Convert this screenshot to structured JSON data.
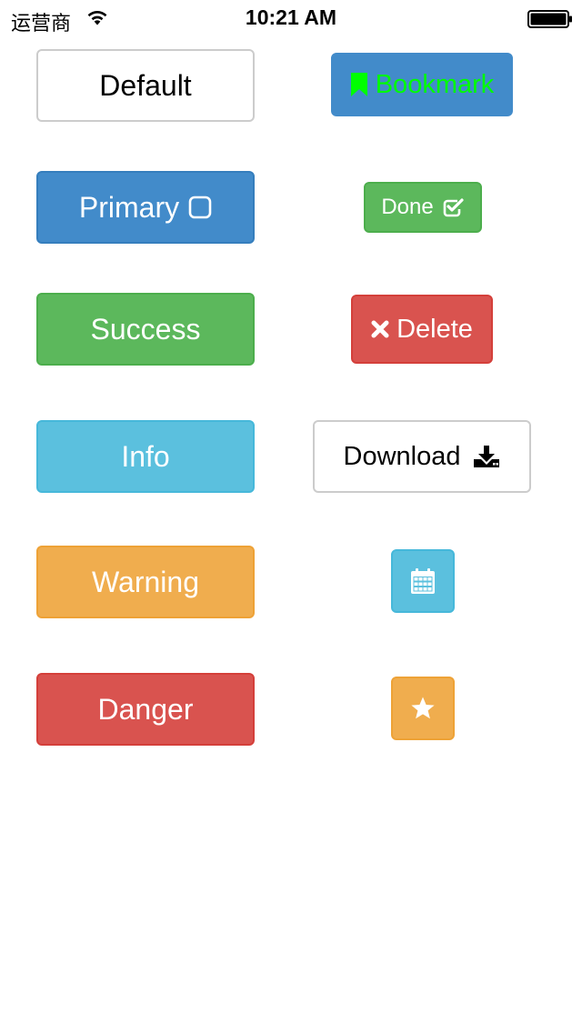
{
  "status_bar": {
    "carrier": "运营商",
    "time": "10:21 AM"
  },
  "buttons": {
    "default": "Default",
    "primary": "Primary",
    "success": "Success",
    "info": "Info",
    "warning": "Warning",
    "danger": "Danger",
    "bookmark": "Bookmark",
    "done": "Done",
    "delete": "Delete",
    "download": "Download"
  },
  "colors": {
    "default": "#ffffff",
    "primary": "#428bca",
    "success": "#5cb85c",
    "info": "#5bc0de",
    "warning": "#f0ad4e",
    "danger": "#d9534f",
    "bookmark_text": "#00ff00"
  },
  "icons": {
    "primary": "checkbox-empty-icon",
    "bookmark": "bookmark-icon",
    "done": "checkbox-checked-icon",
    "delete": "x-icon",
    "download": "download-icon",
    "calendar": "calendar-icon",
    "star": "star-icon"
  }
}
